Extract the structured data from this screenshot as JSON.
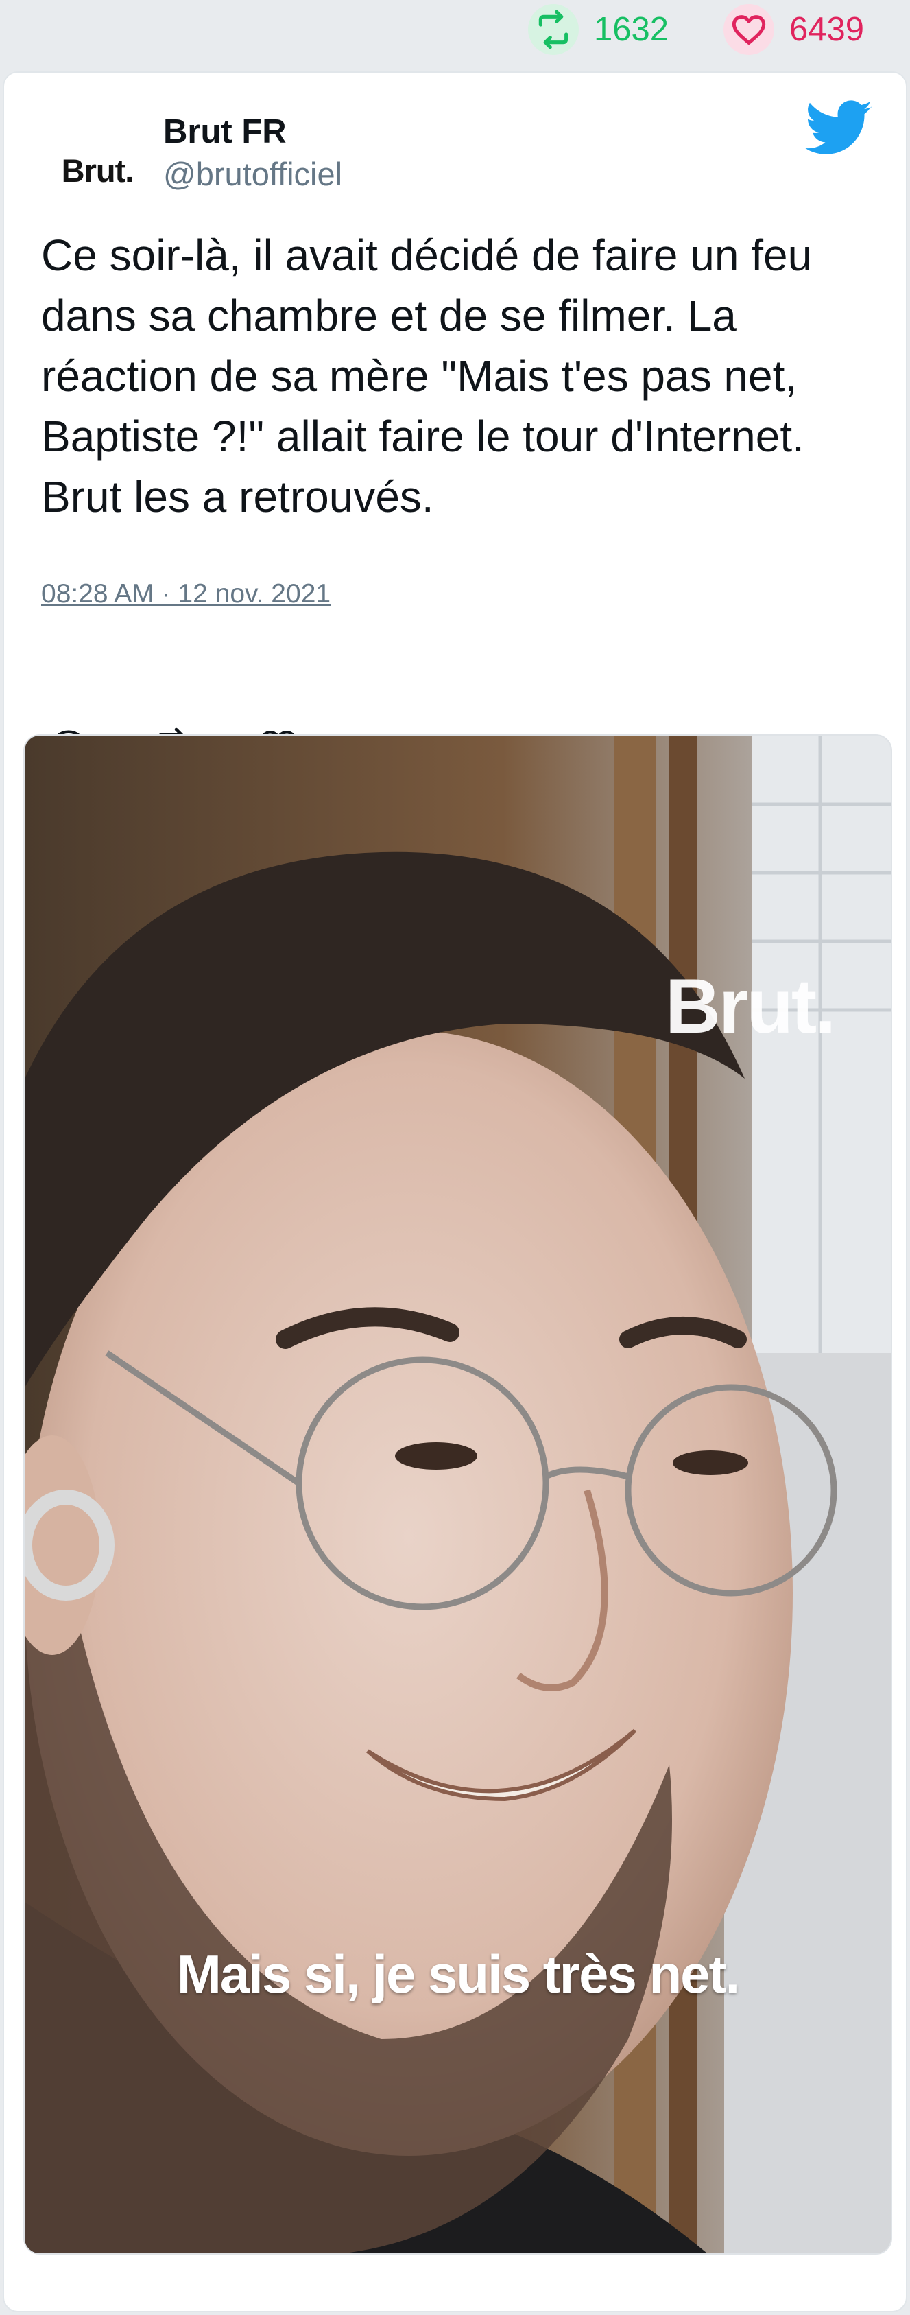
{
  "stats": {
    "retweets": "1632",
    "likes": "6439",
    "retweet_color": "#17bf63",
    "like_color": "#e0245e"
  },
  "tweet": {
    "author_name": "Brut FR",
    "author_handle": "@brutofficiel",
    "avatar_logo": "Brut.",
    "text": "Ce soir-là, il avait décidé de faire un feu dans sa chambre et de se filmer. La réaction de sa mère \"Mais t'es pas net, Baptiste ?!\" allait faire le tour d'Internet. Brut les a retrouvés.",
    "timestamp": "08:28 AM · 12 nov. 2021",
    "brand_color": "#1da1f2"
  },
  "actions": {
    "icons": [
      "reply-icon",
      "retweet-icon",
      "like-icon"
    ]
  },
  "media": {
    "watermark": "Brut.",
    "subtitle": "Mais si, je suis très net."
  }
}
